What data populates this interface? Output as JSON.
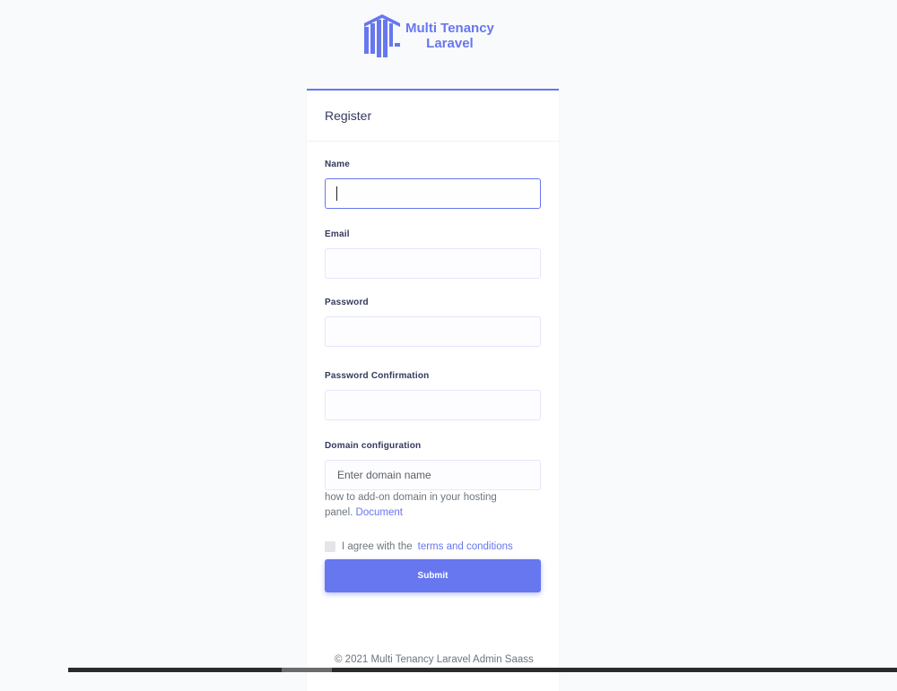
{
  "brand": {
    "line1": "Multi Tenancy",
    "line2": "Laravel",
    "icon": "mtl-logo-icon"
  },
  "colors": {
    "accent": "#6777ef",
    "background": "#f9fafb"
  },
  "card": {
    "title": "Register"
  },
  "form": {
    "name_label": "Name",
    "name_value": "",
    "email_label": "Email",
    "email_value": "",
    "password_label": "Password",
    "password_value": "",
    "password_confirm_label": "Password Confirmation",
    "password_confirm_value": "",
    "domain_label": "Domain configuration",
    "domain_placeholder": "Enter domain name",
    "domain_value": "",
    "help_text": "how to add-on domain in your hosting panel.",
    "help_link": "Document",
    "agree_text": "I agree with the",
    "agree_link": "terms and conditions",
    "agree_checked": false,
    "submit_label": "Submit"
  },
  "footer": {
    "copyright": "© 2021 Multi Tenancy Laravel Admin Saass"
  }
}
